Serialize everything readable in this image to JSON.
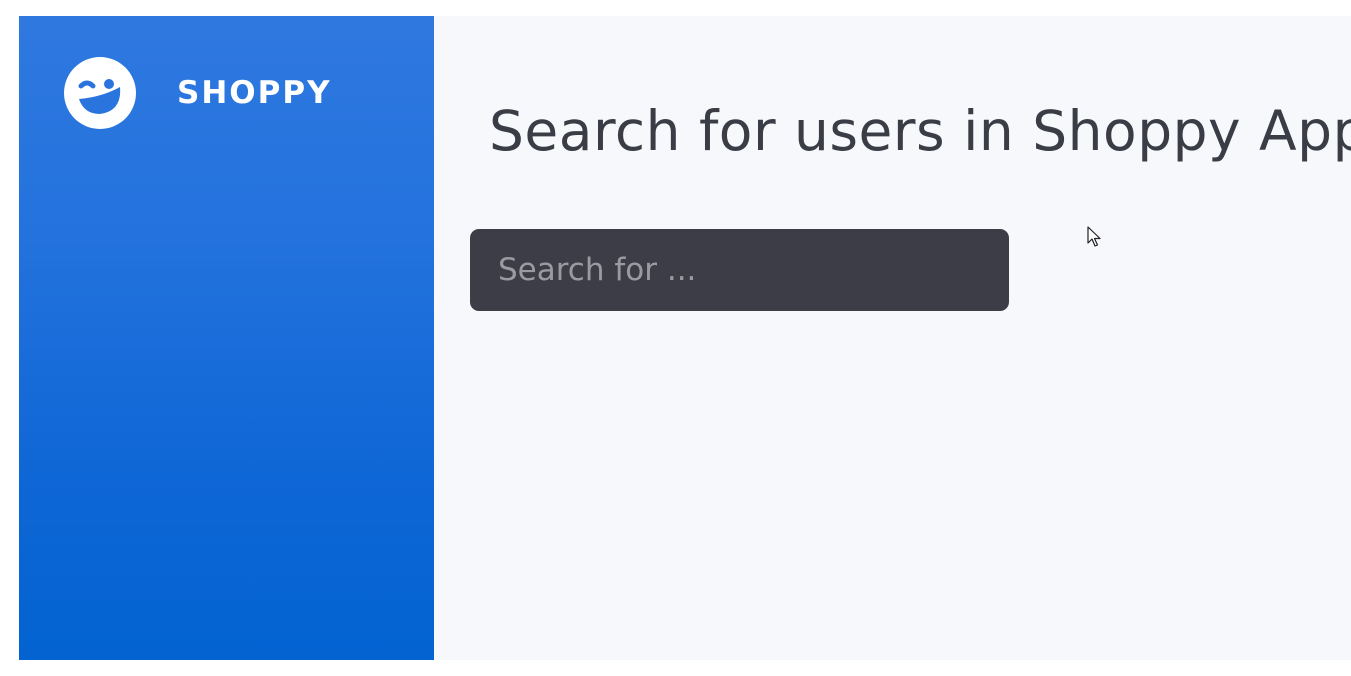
{
  "app": {
    "brand_name": "SHOPPY",
    "logo_icon": "winking-face-icon"
  },
  "main": {
    "title": "Search for users in Shoppy App",
    "search": {
      "placeholder": "Search for ...",
      "value": ""
    }
  },
  "colors": {
    "sidebar_top": "#2f78e0",
    "sidebar_bottom": "#0363d1",
    "main_bg": "#f7f8fc",
    "input_bg": "#3c3d46",
    "title_text": "#3a3d45",
    "placeholder_text": "#9a9ba2"
  }
}
